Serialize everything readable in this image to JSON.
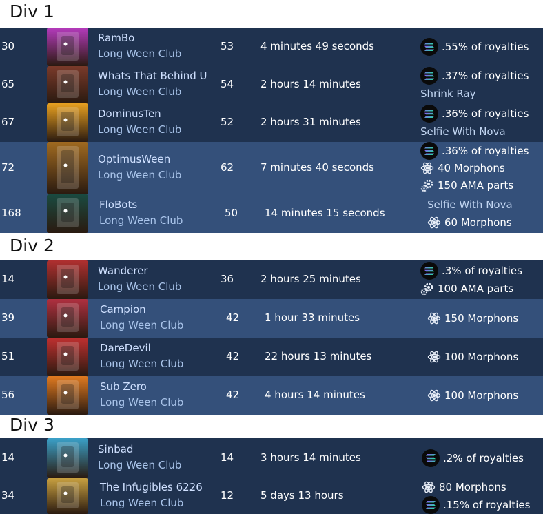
{
  "divisions": [
    {
      "title": "Div 1",
      "rows": [
        {
          "rank": "30",
          "name": "RamBo",
          "club": "Long Ween Club",
          "score": "53",
          "time": "4 minutes 49 seconds",
          "avatar_color": "#b53bbd",
          "rewards": [
            {
              "icon": "solana-icon",
              "text": ".55% of royalties"
            }
          ]
        },
        {
          "rank": "65",
          "name": "Whats That Behind U",
          "club": "Long Ween Club",
          "score": "54",
          "time": "2 hours 14 minutes",
          "avatar_color": "#7a3a2a",
          "rewards": [
            {
              "icon": "solana-icon",
              "text": ".37% of royalties"
            },
            {
              "icon": "",
              "text": "Shrink Ray"
            }
          ]
        },
        {
          "rank": "67",
          "name": "DominusTen",
          "club": "Long Ween Club",
          "score": "52",
          "time": "2 hours 31 minutes",
          "avatar_color": "#e8a020",
          "rewards": [
            {
              "icon": "solana-icon",
              "text": ".36% of royalties"
            },
            {
              "icon": "",
              "text": "Selfie With Nova"
            }
          ]
        },
        {
          "rank": "72",
          "name": "OptimusWeen",
          "club": "Long Ween Club",
          "score": "62",
          "time": "7 minutes 40 seconds",
          "avatar_color": "#a06a20",
          "rewards": [
            {
              "icon": "solana-icon",
              "text": ".36% of royalties"
            },
            {
              "icon": "atom-icon",
              "text": "40 Morphons"
            },
            {
              "icon": "gear-icon",
              "text": "150 AMA parts"
            }
          ]
        },
        {
          "rank": "168",
          "name": "FloBots",
          "club": "Long Ween Club",
          "score": "50",
          "time": "14 minutes 15 seconds",
          "avatar_color": "#1a4a40",
          "rewards": [
            {
              "icon": "",
              "text": "Selfie With Nova"
            },
            {
              "icon": "atom-icon",
              "text": "60 Morphons"
            }
          ]
        }
      ]
    },
    {
      "title": "Div 2",
      "rows": [
        {
          "rank": "14",
          "name": "Wanderer",
          "club": "Long Ween Club",
          "score": "36",
          "time": "2 hours 25 minutes",
          "avatar_color": "#b03030",
          "rewards": [
            {
              "icon": "solana-icon",
              "text": ".3% of royalties"
            },
            {
              "icon": "gear-icon",
              "text": "100 AMA parts"
            }
          ]
        },
        {
          "rank": "39",
          "name": "Campion",
          "club": "Long Ween Club",
          "score": "42",
          "time": "1 hour 33 minutes",
          "avatar_color": "#b03040",
          "rewards": [
            {
              "icon": "atom-icon",
              "text": "150 Morphons"
            }
          ]
        },
        {
          "rank": "51",
          "name": "DareDevil",
          "club": "Long Ween Club",
          "score": "42",
          "time": "22 hours 13 minutes",
          "avatar_color": "#c03030",
          "rewards": [
            {
              "icon": "atom-icon",
              "text": "100 Morphons"
            }
          ]
        },
        {
          "rank": "56",
          "name": "Sub Zero",
          "club": "Long Ween Club",
          "score": "42",
          "time": "4 hours 14 minutes",
          "avatar_color": "#e07a20",
          "rewards": [
            {
              "icon": "atom-icon",
              "text": "100 Morphons"
            }
          ]
        }
      ]
    },
    {
      "title": "Div 3",
      "rows": [
        {
          "rank": "14",
          "name": "Sinbad",
          "club": "Long Ween Club",
          "score": "14",
          "time": "3 hours 14 minutes",
          "avatar_color": "#3aa0c8",
          "rewards": [
            {
              "icon": "solana-icon",
              "text": ".2% of royalties"
            }
          ]
        },
        {
          "rank": "34",
          "name": "The Infugibles 6226",
          "club": "Long Ween Club",
          "score": "12",
          "time": "5 days 13 hours",
          "avatar_color": "#c8a040",
          "rewards": [
            {
              "icon": "atom-icon",
              "text": "80 Morphons"
            },
            {
              "icon": "solana-icon",
              "text": ".15% of royalties"
            }
          ]
        }
      ]
    }
  ]
}
